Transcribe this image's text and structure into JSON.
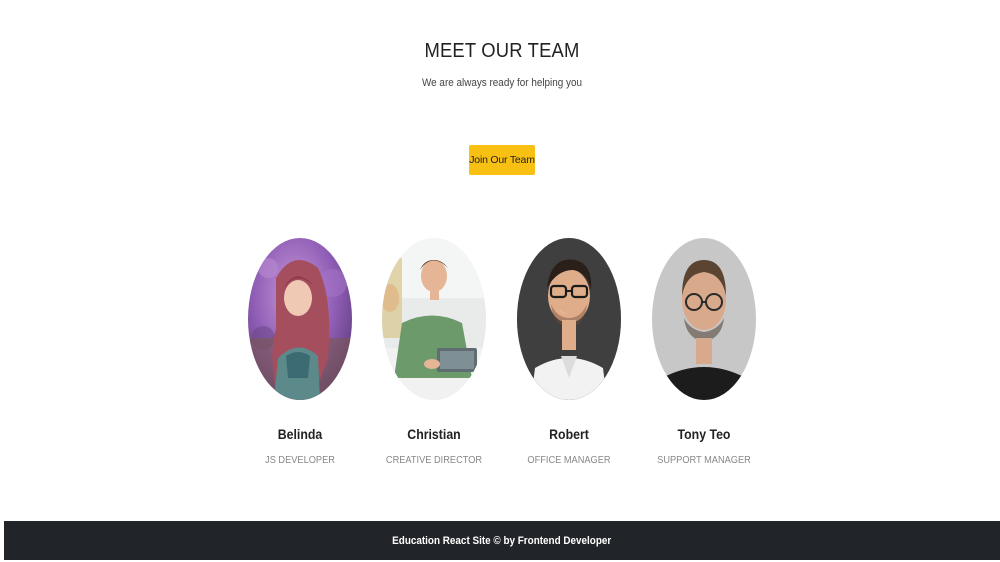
{
  "section": {
    "title": "MEET OUR TEAM",
    "subtitle": "We are always ready for helping you",
    "join_button_label": "Join Our Team"
  },
  "team": [
    {
      "name": "Belinda",
      "role": "JS DEVELOPER"
    },
    {
      "name": "Christian",
      "role": "CREATIVE DIRECTOR"
    },
    {
      "name": "Robert",
      "role": "OFFICE MANAGER"
    },
    {
      "name": "Tony Teo",
      "role": "SUPPORT MANAGER"
    }
  ],
  "footer": {
    "text": "Education React Site © by Frontend Developer"
  },
  "colors": {
    "accent": "#f8c012",
    "footer_bg": "#212428",
    "role_text": "#888888"
  }
}
